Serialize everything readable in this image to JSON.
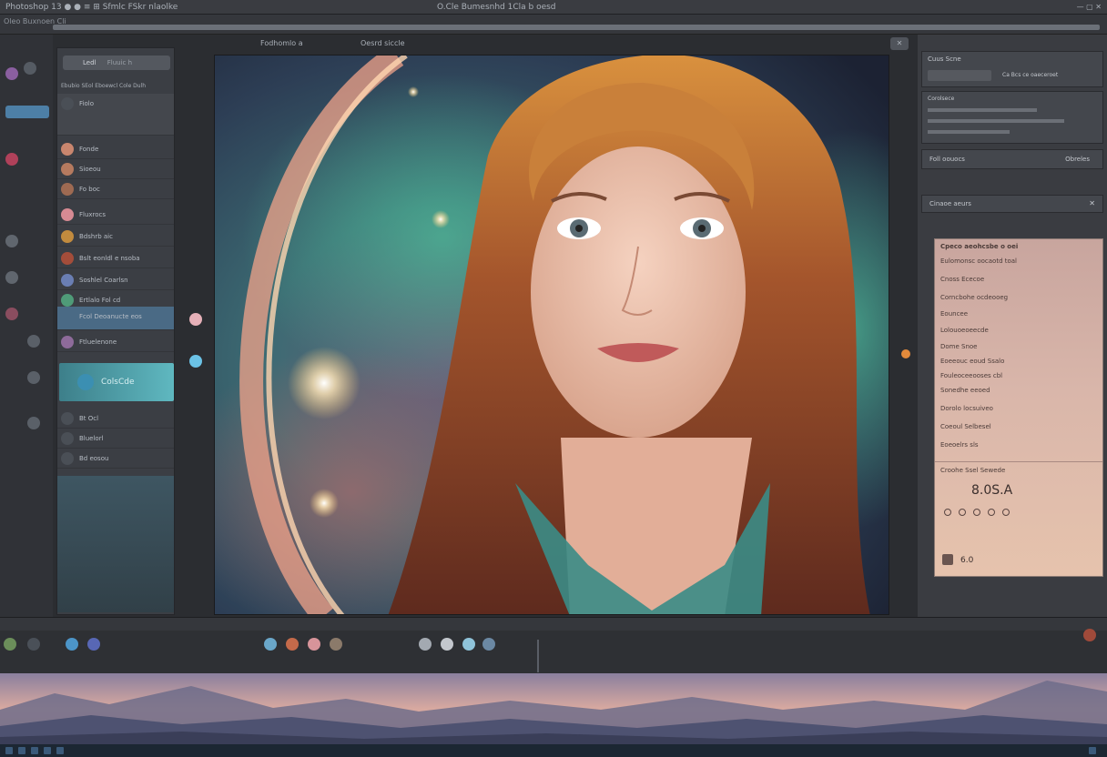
{
  "titlebar": {
    "app_title": "Oleo Buxnoen Cli",
    "left_text": "Photoshop   13   ●   ●  ≡  ⊞   Sfmlc FSkr nlaolke",
    "center_text": "O.Cle Bumesnhd 1Cla   b oesd"
  },
  "tabbar": {
    "tab1": "Fodhomlo a",
    "tab2": "Oesrd siccle"
  },
  "layers": {
    "search_value": "Ledl",
    "search_sub": "Fluuic h",
    "header": "Ebubio SEol Eboewcl Cole Dulh",
    "items": [
      {
        "label": "Fiolo"
      },
      {
        "label": "Fonde"
      },
      {
        "label": "Sioeou"
      },
      {
        "label": "Fo boc"
      },
      {
        "label": "Fluxrocs"
      },
      {
        "label": "Bdshrb aic"
      },
      {
        "label": "Bslt eonldl e nsoba"
      },
      {
        "label": "Soshlel Coarlsn"
      },
      {
        "label": "Ertlalo Fol cd"
      },
      {
        "label": "Fcol Deoanucte eos"
      },
      {
        "label": "Ftluelenone"
      },
      {
        "label": "Bt Ocl"
      },
      {
        "label": "Bluelorl"
      },
      {
        "label": "Bd eosou"
      }
    ],
    "active_label": "ColsCde"
  },
  "right": {
    "header1": "Cuus Scne",
    "line1": "Ca  Bcs ce oaeceroet",
    "line2": "Corolsece",
    "section2": "Foll oouocs",
    "section2_right": "Obreles",
    "section3": "Cinaoe aeurs",
    "props_title": "Cpeco aeohcsbe o oei",
    "props_rows": [
      "Eulomonsc oocaotd toal",
      "Cnoss Ececoe",
      "Corncbohe ocdeooeg",
      "Eouncee",
      "Lolouoeoeecde",
      "Dome Snoe",
      "Eoeeouc eoud Ssalo",
      "Fouleoceeooses cbl",
      "Sonedhe eeoed",
      "Dorolo locsuiveo",
      "Coeoul Selbesel",
      "Eoeoelrs sls"
    ],
    "props_footer": "Croohe Ssel Sewede",
    "value_big": "8.0S.A",
    "value_small": "6.0"
  },
  "colors": {
    "accent_teal": "#5fb8c0",
    "panel_bg": "#3b3e44",
    "props_bg": "#d4b0a5"
  },
  "icons": [
    "search-icon",
    "brush-icon",
    "eye-icon",
    "layer-icon",
    "gear-icon",
    "close-icon"
  ]
}
